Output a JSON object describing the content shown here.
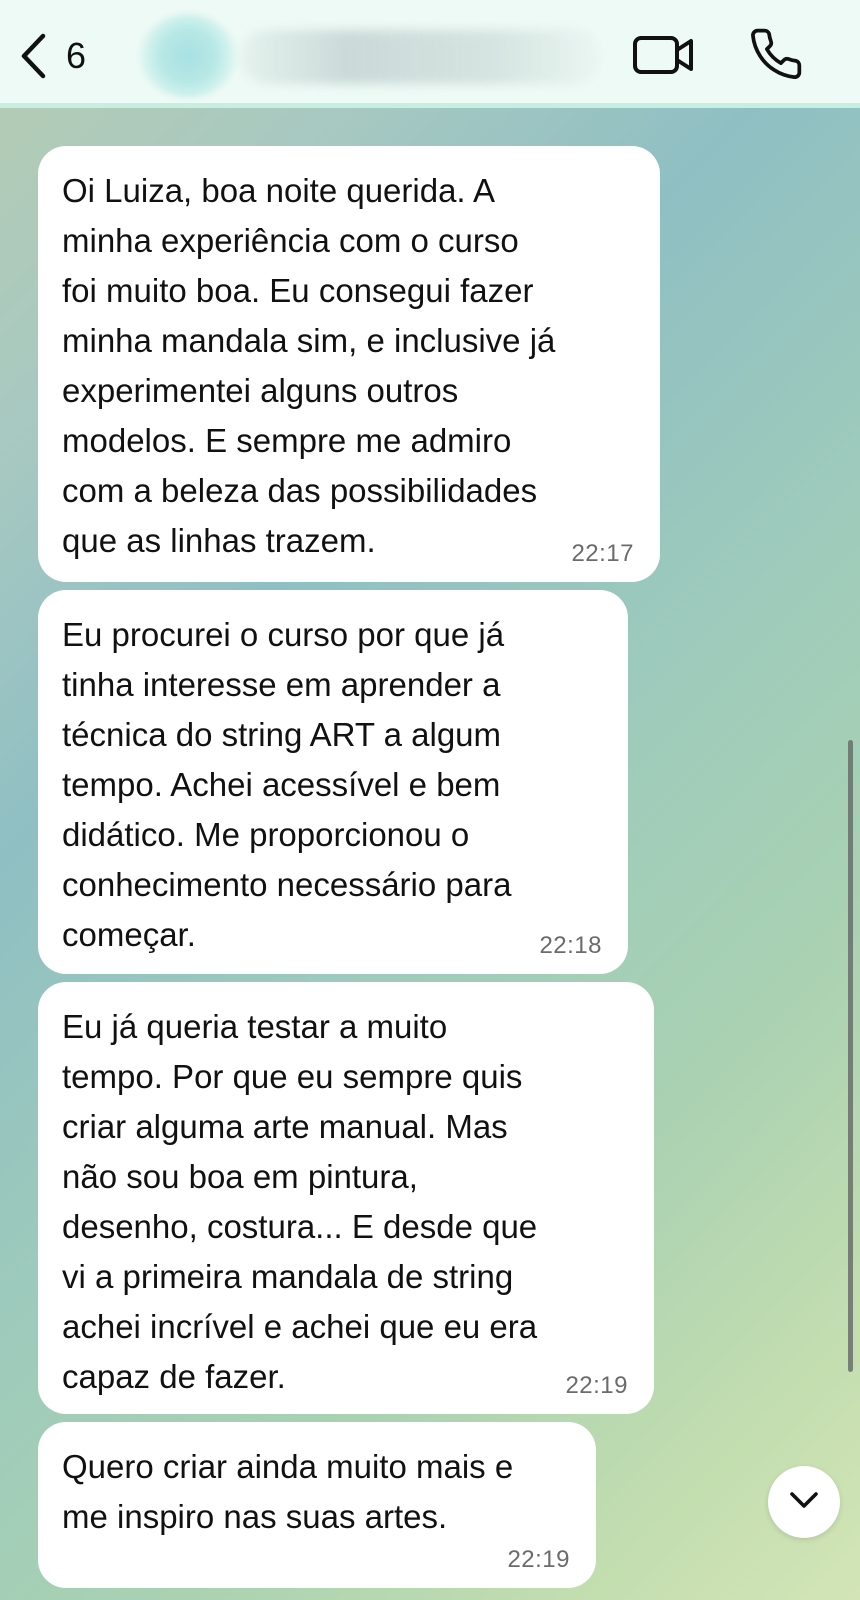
{
  "header": {
    "back_count": "6",
    "contact_name": "",
    "icons": {
      "back": "chevron-left-icon",
      "video": "video-camera-icon",
      "call": "phone-icon"
    }
  },
  "messages": [
    {
      "text": "Oi Luiza, boa noite querida. A\nminha experiência com o curso\nfoi muito boa. Eu consegui fazer\nminha mandala sim, e inclusive já\nexperimentei alguns outros\nmodelos. E sempre me admiro\ncom a beleza das possibilidades\nque as linhas trazem.",
      "time": "22:17"
    },
    {
      "text": "Eu procurei o curso por que já\ntinha interesse em aprender a\ntécnica do string ART a algum\ntempo. Achei acessível e bem\ndidático. Me proporcionou o\nconhecimento necessário para\ncomeçar.",
      "time": "22:18"
    },
    {
      "text": "Eu já queria testar a muito\ntempo. Por que eu sempre quis\ncriar alguma arte manual. Mas\nnão sou boa em pintura,\ndesenho, costura... E desde que\nvi a primeira mandala de string\nachei incrível e achei que eu era\ncapaz de fazer.",
      "time": "22:19"
    },
    {
      "text": "Quero criar ainda muito mais e\nme inspiro nas suas artes.",
      "time": "22:19"
    }
  ],
  "scroll_down_icon": "chevron-down-icon",
  "colors": {
    "header_bg": "#eefaf6",
    "bubble_bg": "#ffffff",
    "time_text": "#6b6b6b"
  }
}
